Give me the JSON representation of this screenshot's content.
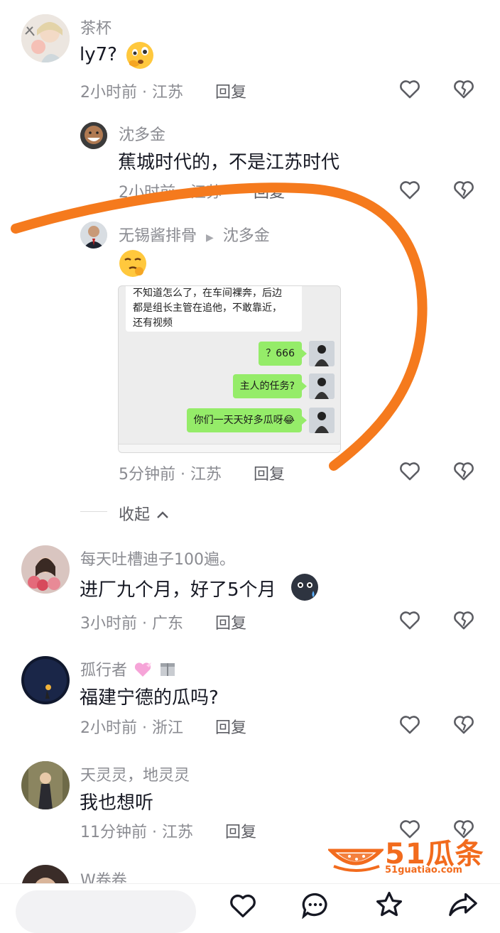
{
  "comments": [
    {
      "name": "茶杯",
      "text": "ly7?",
      "time": "2小时前",
      "region": "江苏",
      "reply": "回复"
    },
    {
      "name": "沈多金",
      "text": "蕉城时代的，不是江苏时代",
      "time": "2小时前",
      "region": "江苏",
      "reply": "回复"
    },
    {
      "name": "无锡酱排骨",
      "reply_to": "沈多金",
      "time": "5分钟前",
      "region": "江苏",
      "reply": "回复"
    },
    {
      "name": "每天吐槽迪子100遍。",
      "text": "进厂九个月，好了5个月",
      "time": "3小时前",
      "region": "广东",
      "reply": "回复"
    },
    {
      "name": "孤行者",
      "text": "福建宁德的瓜吗?",
      "time": "2小时前",
      "region": "浙江",
      "reply": "回复"
    },
    {
      "name": "天灵灵，地灵灵",
      "text": "我也想听",
      "time": "11分钟前",
      "region": "江苏",
      "reply": "回复"
    },
    {
      "name": "W卷卷"
    }
  ],
  "sep": " · ",
  "collapse_label": "收起",
  "chat": {
    "incoming_lines": [
      "不知道怎么了，在车间裸奔，后边",
      "都是组长主管在追他，不敢靠近，",
      "还有视频"
    ],
    "outgoing": [
      "？666",
      "主人的任务?",
      "你们一天天好多瓜呀😂"
    ]
  },
  "watermark": {
    "brand": "51瓜条",
    "url": "51guatiao.com"
  },
  "colors": {
    "annotation": "#f57a1d",
    "bubble": "#95ec69",
    "muted": "#8a8b91"
  },
  "icons": [
    "heart-icon",
    "broken-heart-icon",
    "chevron-up-icon",
    "comment-icon",
    "star-icon",
    "share-icon"
  ]
}
